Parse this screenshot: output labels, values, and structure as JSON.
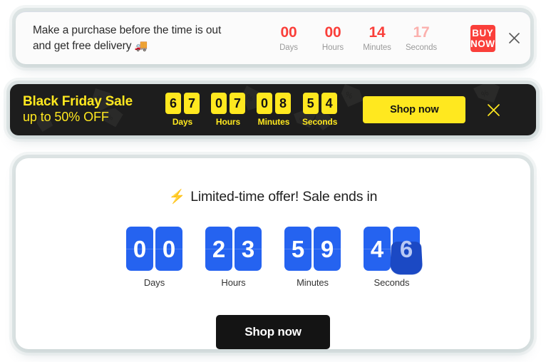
{
  "banner_white": {
    "message": "Make a purchase before the time is out and get free delivery",
    "emoji": "🚚",
    "timer": {
      "units": [
        {
          "value": "00",
          "label": "Days",
          "dim": false
        },
        {
          "value": "00",
          "label": "Hours",
          "dim": false
        },
        {
          "value": "14",
          "label": "Minutes",
          "dim": false
        },
        {
          "value": "17",
          "label": "Seconds",
          "dim": true
        }
      ]
    },
    "cta_label": "BUY NOW",
    "close_icon": "close-icon",
    "colors": {
      "accent": "#fa3f3a",
      "accent_dim": "#fbb0ad",
      "background": "#fbfbfb"
    }
  },
  "banner_black": {
    "headline_line1": "Black Friday Sale",
    "headline_line2": "up to 50% OFF",
    "timer": {
      "units": [
        {
          "digits": [
            "6",
            "7"
          ],
          "label": "Days"
        },
        {
          "digits": [
            "0",
            "7"
          ],
          "label": "Hours"
        },
        {
          "digits": [
            "0",
            "8"
          ],
          "label": "Minutes"
        },
        {
          "digits": [
            "5",
            "4"
          ],
          "label": "Seconds"
        }
      ]
    },
    "cta_label": "Shop now",
    "close_icon": "close-icon",
    "colors": {
      "accent": "#ffe81f",
      "background": "#1d1d1d"
    }
  },
  "panel_blue": {
    "heading": "Limited-time offer! Sale ends in",
    "heading_icon": "lightning-bolt-icon",
    "heading_emoji": "⚡",
    "timer": {
      "units": [
        {
          "digits": [
            "0",
            "0"
          ],
          "label": "Days",
          "flipping_index": -1
        },
        {
          "digits": [
            "2",
            "3"
          ],
          "label": "Hours",
          "flipping_index": -1
        },
        {
          "digits": [
            "5",
            "9"
          ],
          "label": "Minutes",
          "flipping_index": -1
        },
        {
          "digits": [
            "4",
            "6"
          ],
          "label": "Seconds",
          "flipping_index": 1
        }
      ]
    },
    "cta_label": "Shop now",
    "colors": {
      "accent": "#2563f0",
      "accent_dark": "#1b49c4",
      "cta_background": "#141414",
      "background": "#ffffff"
    }
  }
}
